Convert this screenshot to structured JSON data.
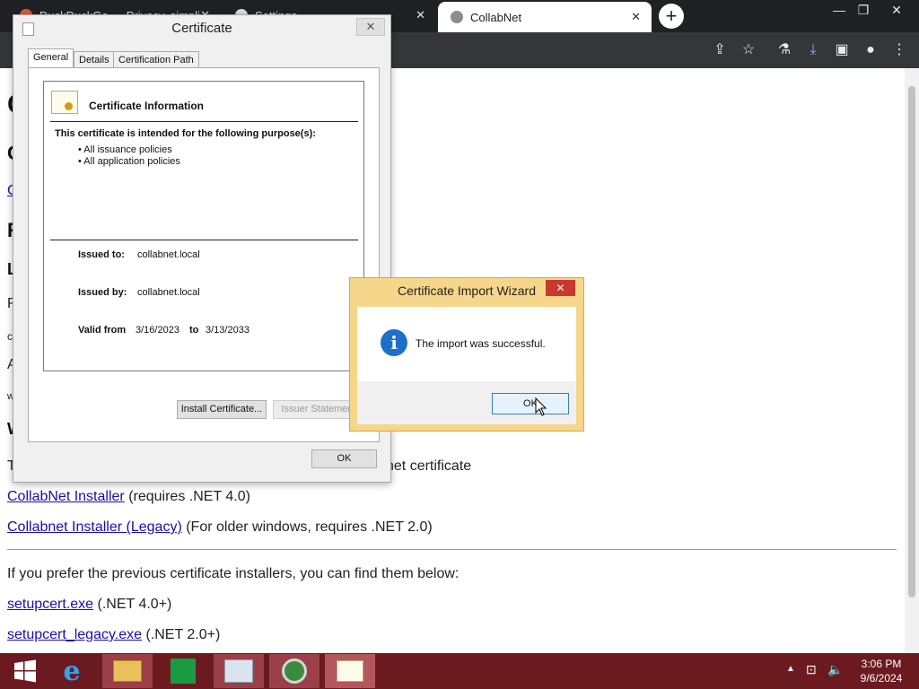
{
  "browser": {
    "tabs": [
      {
        "label": "DuckDuckGo — Privacy, simplified."
      },
      {
        "label": "Settings"
      },
      {
        "label": "CollabNet"
      }
    ],
    "close_glyph": "✕",
    "new_tab_glyph": "+",
    "window_controls": [
      "—",
      "❐",
      "✕"
    ]
  },
  "page": {
    "first_heading_letters": [
      "C",
      "C",
      "R",
      "L",
      "W"
    ],
    "link_letter": "C",
    "text_letters": [
      "R",
      "c",
      "A",
      "w"
    ],
    "partial_line_right": "net certificate",
    "partial_line_left": "T",
    "installer_link": "CollabNet Installer",
    "installer_note": "(requires .NET 4.0)",
    "legacy_link": "Collabnet Installer (Legacy)",
    "legacy_note": "(For older windows, requires .NET 2.0)",
    "prev_text": "If you prefer the previous certificate installers, you can find them below:",
    "setup_link": "setupcert.exe",
    "setup_note": "(.NET 4.0+)",
    "setup_legacy_link": "setupcert_legacy.exe",
    "setup_legacy_note": "(.NET 2.0+)"
  },
  "certificate_dialog": {
    "title": "Certificate",
    "close": "✕",
    "tabs": [
      "General",
      "Details",
      "Certification Path"
    ],
    "info_title": "Certificate Information",
    "purpose_heading": "This certificate is intended for the following purpose(s):",
    "purposes": [
      "• All issuance policies",
      "• All application policies"
    ],
    "issued_to_label": "Issued to:",
    "issued_to_value": "collabnet.local",
    "issued_by_label": "Issued by:",
    "issued_by_value": "collabnet.local",
    "valid_from_label": "Valid from",
    "valid_from_value": "3/16/2023",
    "valid_to_label": "to",
    "valid_to_value": "3/13/2033",
    "install_button": "Install Certificate...",
    "issuer_button": "Issuer Statement",
    "ok_button": "OK"
  },
  "wizard_dialog": {
    "title": "Certificate Import Wizard",
    "close": "✕",
    "icon": "info-icon",
    "message": "The import was successful.",
    "ok_button": "OK"
  },
  "taskbar": {
    "time": "3:06 PM",
    "date": "9/6/2024",
    "items": [
      "start-icon",
      "internet-explorer-icon",
      "file-explorer-icon",
      "store-icon",
      "performance-monitor-icon",
      "chrome-icon",
      "certificate-icon"
    ]
  },
  "colors": {
    "taskbar": "#6b1b20",
    "wizard_frame": "#f6d68b",
    "info": "#1e6fc7",
    "link": "#1a0dab"
  }
}
